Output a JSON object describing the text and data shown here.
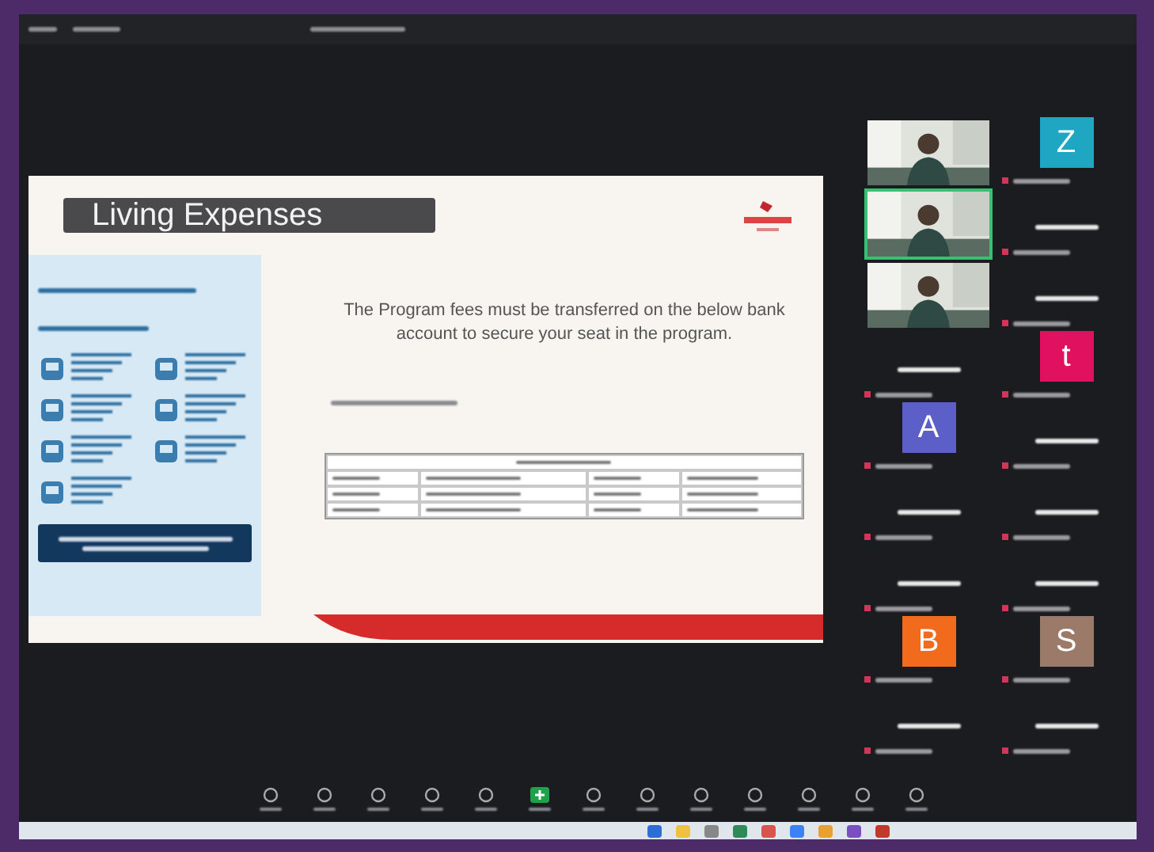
{
  "slide": {
    "title": "Living Expenses",
    "message": "The Program fees must be transferred on the below bank account to secure your seat in the program."
  },
  "participants": [
    {
      "kind": "video",
      "speaking": false
    },
    {
      "kind": "avatar",
      "initial": "Z",
      "color": "#1fa6c2"
    },
    {
      "kind": "video",
      "speaking": true
    },
    {
      "kind": "name"
    },
    {
      "kind": "video",
      "speaking": false
    },
    {
      "kind": "name"
    },
    {
      "kind": "name"
    },
    {
      "kind": "avatar",
      "initial": "t",
      "color": "#e0115f"
    },
    {
      "kind": "avatar",
      "initial": "A",
      "color": "#5b5fc7"
    },
    {
      "kind": "name"
    },
    {
      "kind": "name"
    },
    {
      "kind": "name"
    },
    {
      "kind": "name"
    },
    {
      "kind": "name"
    },
    {
      "kind": "avatar",
      "initial": "B",
      "color": "#f26b1d"
    },
    {
      "kind": "avatar",
      "initial": "S",
      "color": "#9c7a6a"
    },
    {
      "kind": "name"
    },
    {
      "kind": "name"
    }
  ],
  "toolbar": [
    {
      "kind": "plain"
    },
    {
      "kind": "plain"
    },
    {
      "kind": "plain"
    },
    {
      "kind": "plain"
    },
    {
      "kind": "plain"
    },
    {
      "kind": "share"
    },
    {
      "kind": "plain"
    },
    {
      "kind": "plain"
    },
    {
      "kind": "plain"
    },
    {
      "kind": "plain"
    },
    {
      "kind": "plain"
    },
    {
      "kind": "plain"
    },
    {
      "kind": "plain"
    }
  ]
}
